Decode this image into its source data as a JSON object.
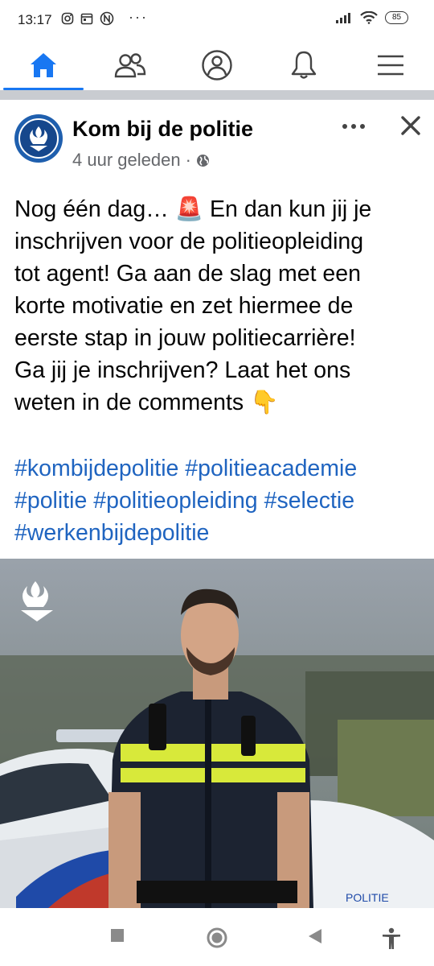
{
  "status_bar": {
    "time": "13:17",
    "overflow": "···",
    "battery": "85"
  },
  "nav": {
    "tabs": [
      {
        "icon": "home-icon",
        "active": true
      },
      {
        "icon": "friends-icon",
        "active": false
      },
      {
        "icon": "profile-icon",
        "active": false
      },
      {
        "icon": "bell-icon",
        "active": false
      },
      {
        "icon": "menu-icon",
        "active": false
      }
    ],
    "accent": "#1877f2"
  },
  "post": {
    "page_name": "Kom bij de politie",
    "timestamp": "4 uur geleden",
    "visibility_separator": "·",
    "text_lines": [
      "Nog één dag… 🚨 En dan kun jij je",
      "inschrijven voor de politieopleiding",
      "tot agent! Ga aan de slag met een",
      "korte motivatie en zet hiermee de",
      "eerste stap in jouw politiecarrière!",
      "Ga jij je inschrijven? Laat het ons",
      "weten in de comments 👇"
    ],
    "hashtags": [
      "#kombijdepolitie",
      "#politieacademie",
      "#politie",
      "#politieopleiding",
      "#selectie",
      "#werkenbijdepolitie"
    ],
    "hashtag_color": "#1f64c0",
    "photo_caption_vehicle": "POLITIE"
  }
}
